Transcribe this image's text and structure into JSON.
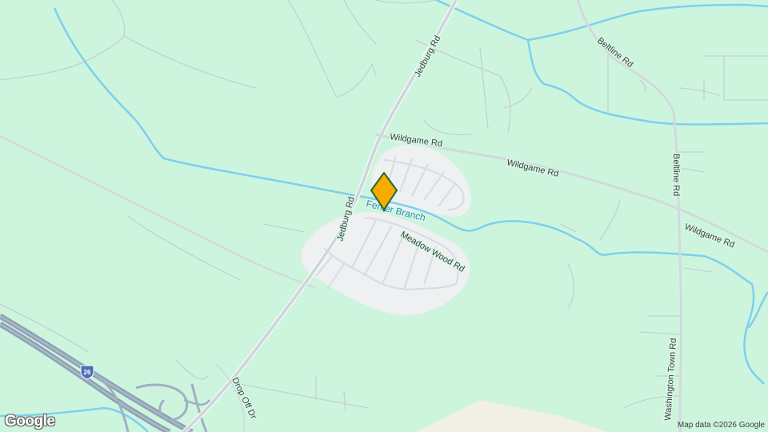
{
  "map": {
    "roads": {
      "jedburg_top": "Jedburg Rd",
      "jedburg_mid": "Jedburg Rd",
      "beltline_top": "Beltline Rd",
      "beltline_side": "Beltline Rd",
      "wildgame_1": "Wildgame Rd",
      "wildgame_2": "Wildgame Rd",
      "wildgame_3": "Wildgame Rd",
      "meadow_wood": "Meadow Wood Rd",
      "drop_off": "Drop Off Dr",
      "washington_town": "Washington Town Rd"
    },
    "waterways": {
      "fenter_branch": "Fenter Branch"
    },
    "interstate_shield": "26",
    "marker": {
      "color": "#f9ab00",
      "icon": "location-pin-icon"
    }
  },
  "branding": {
    "logo": "Google",
    "attribution": "Map data ©2026 Google"
  },
  "colors": {
    "land": "#cdf5dd",
    "water": "#7fcfee",
    "road": "#d5d9de",
    "highway": "#8b9cb3",
    "residential": "#eef0f2",
    "marker_fill": "#f9ab00",
    "marker_stroke": "#1e6b30"
  }
}
